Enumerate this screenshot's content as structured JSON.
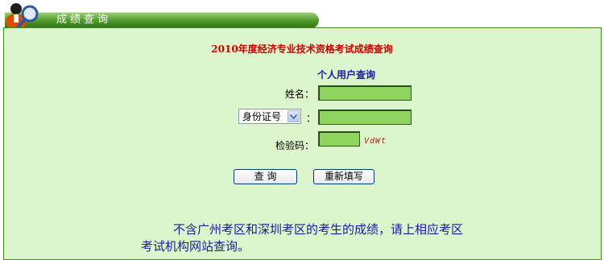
{
  "header": {
    "title": "成绩查询"
  },
  "form": {
    "title": "2010年度经济专业技术资格考试成绩查询",
    "section_title": "个人用户查询",
    "name_label": "姓名：",
    "id_type_selected": "身份证号",
    "id_colon": "：",
    "captcha_label": "检验码：",
    "captcha_value": "VdWt",
    "query_button": "查  询",
    "reset_button": "重新填写"
  },
  "notice": {
    "text": "不含广州考区和深圳考区的考生的成绩，请上相应考区考试机构网站查询。"
  },
  "colors": {
    "panel_bg": "#dcf5cb",
    "tab_green": "#4e9a2a",
    "input_green": "#8fd45f",
    "title_red": "#cc0000",
    "text_blue": "#1a1aa6"
  }
}
